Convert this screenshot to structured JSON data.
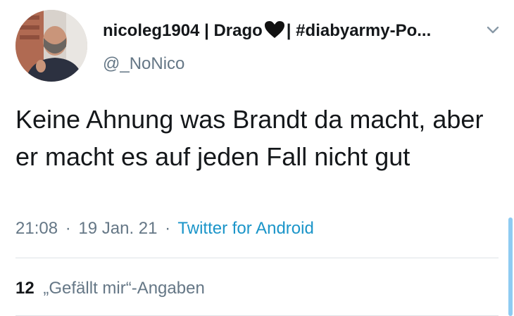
{
  "user": {
    "display_name_prefix": "nicoleg1904 | Drago",
    "display_name_suffix": " | #diabyarmy-Po...",
    "handle": "@_NoNico",
    "avatar_icon": "profile-photo",
    "heart_icon": "black-heart-icon"
  },
  "tweet": {
    "text": "Keine Ahnung was Brandt da macht, aber er macht es auf jeden Fall nicht gut",
    "time": "21:08",
    "date": "19 Jan. 21",
    "separator": "·",
    "source": "Twitter for Android"
  },
  "stats": {
    "likes_count": "12",
    "likes_label": "„Gefällt mir“-Angaben"
  },
  "colors": {
    "text": "#14171a",
    "muted": "#657786",
    "link": "#1b95c9",
    "scroll_indicator": "#8ecbf2"
  }
}
